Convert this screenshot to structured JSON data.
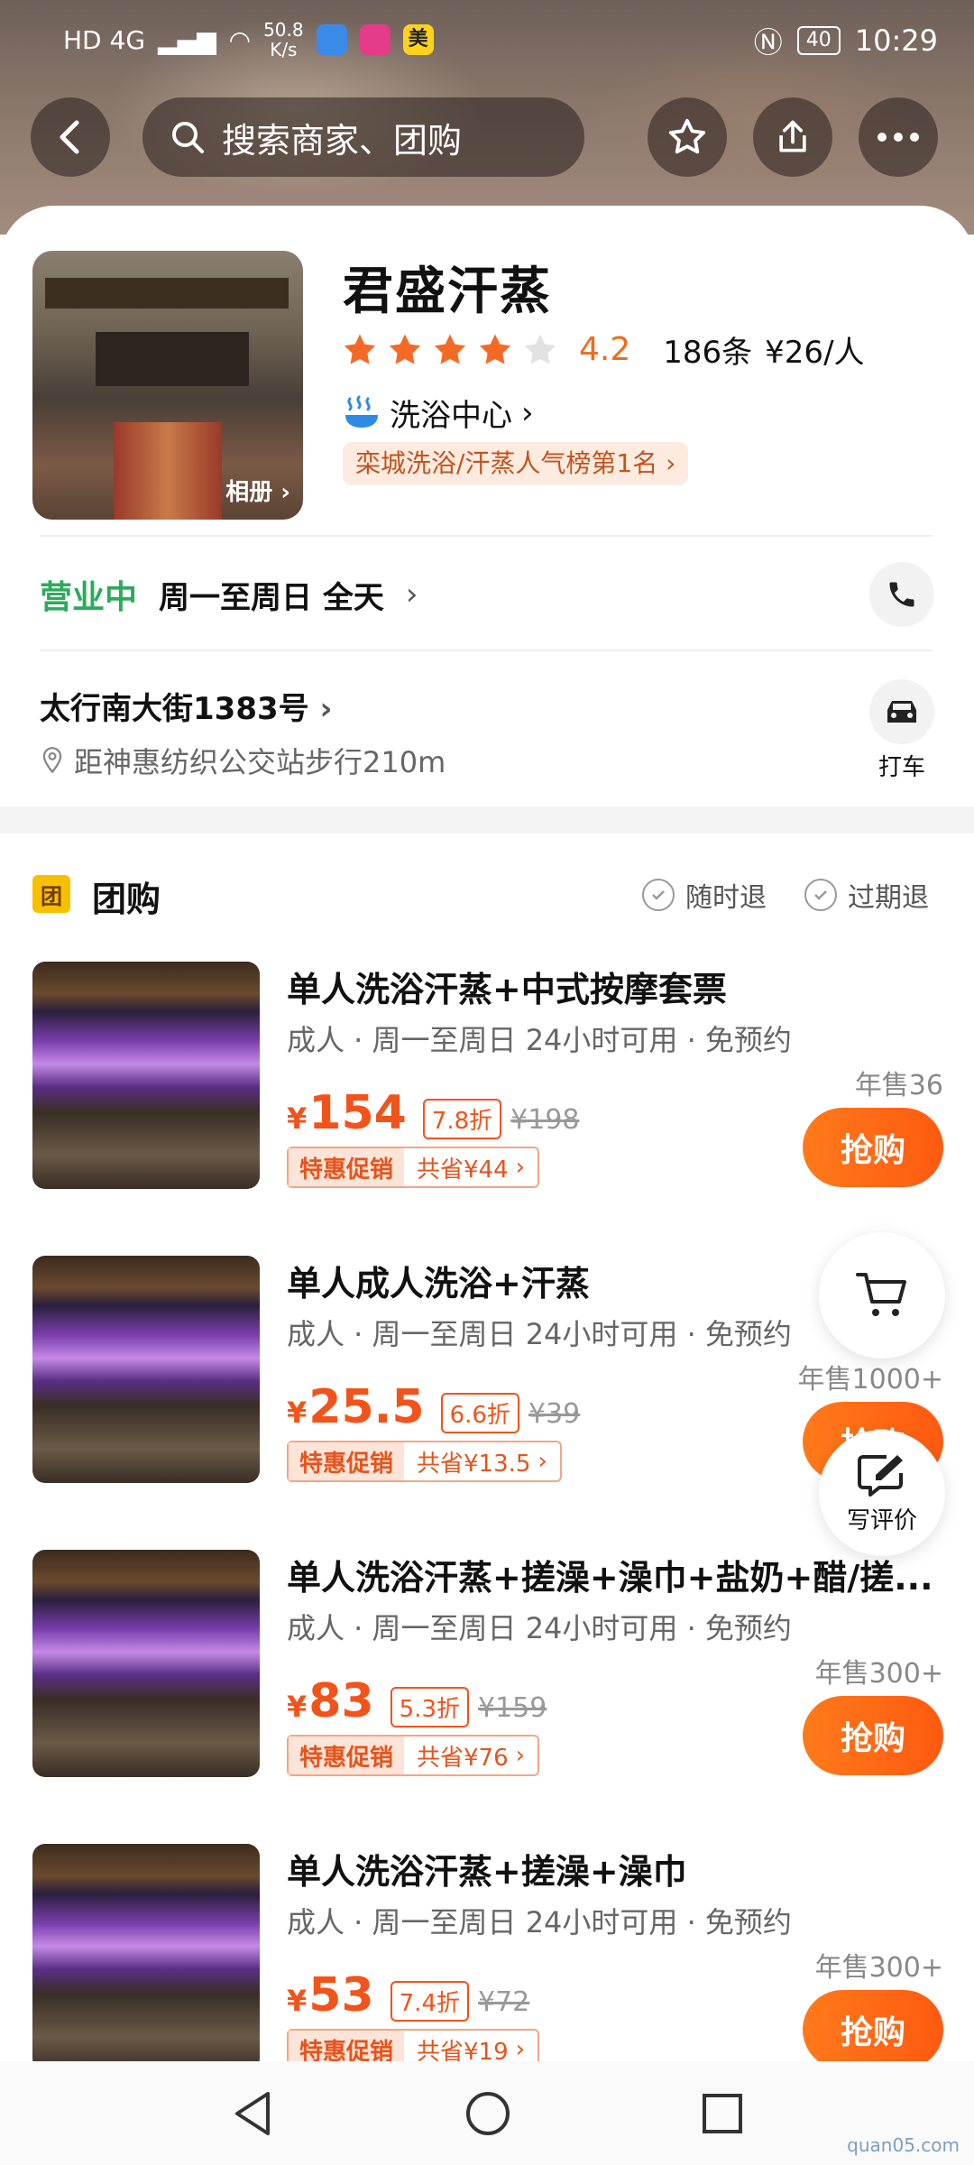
{
  "status_bar": {
    "network": "HD 4G",
    "speed_value": "50.8",
    "speed_unit": "K/s",
    "app_badge": "美",
    "battery": "40",
    "time": "10:29"
  },
  "top_nav": {
    "search_placeholder": "搜索商家、团购"
  },
  "shop": {
    "album_label": "相册",
    "name": "君盛汗蒸",
    "rating": 4.2,
    "rating_text": "4.2",
    "review_count": "186条",
    "avg_price": "¥26/人",
    "category": "洗浴中心",
    "rank_tag": "栾城洗浴/汗蒸人气榜第1名",
    "open_status": "营业中",
    "hours": "周一至周日 全天",
    "address": "太行南大街1383号",
    "distance": "距神惠纺织公交站步行210m",
    "taxi_label": "打车"
  },
  "group": {
    "logo": "团",
    "title": "团购",
    "policy_1": "随时退",
    "policy_2": "过期退"
  },
  "deals": [
    {
      "title": "单人洗浴汗蒸+中式按摩套票",
      "subtitle": "成人 · 周一至周日 24小时可用 · 免预约",
      "yen": "¥",
      "price": "154",
      "discount": "7.8折",
      "original": "¥198",
      "sold": "年售36",
      "promo": "特惠促销",
      "saving": "共省¥44",
      "buy": "抢购"
    },
    {
      "title": "单人成人洗浴+汗蒸",
      "subtitle": "成人 · 周一至周日 24小时可用 · 免预约",
      "yen": "¥",
      "price": "25.5",
      "discount": "6.6折",
      "original": "¥39",
      "sold": "年售1000+",
      "promo": "特惠促销",
      "saving": "共省¥13.5",
      "buy": "抢购"
    },
    {
      "title": "单人洗浴汗蒸+搓澡+澡巾+盐奶+醋/搓...",
      "subtitle": "成人 · 周一至周日 24小时可用 · 免预约",
      "yen": "¥",
      "price": "83",
      "discount": "5.3折",
      "original": "¥159",
      "sold": "年售300+",
      "promo": "特惠促销",
      "saving": "共省¥76",
      "buy": "抢购"
    },
    {
      "title": "单人洗浴汗蒸+搓澡+澡巾",
      "subtitle": "成人 · 周一至周日 24小时可用 · 免预约",
      "yen": "¥",
      "price": "53",
      "discount": "7.4折",
      "original": "¥72",
      "sold": "年售300+",
      "promo": "特惠促销",
      "saving": "共省¥19",
      "buy": "抢购"
    }
  ],
  "floating": {
    "review_label": "写评价"
  },
  "watermark": "quan05.com",
  "colors": {
    "accent": "#f2531b",
    "open_green": "#2daa5c",
    "rating_orange": "#f06a1a",
    "group_yellow": "#f6c000"
  }
}
